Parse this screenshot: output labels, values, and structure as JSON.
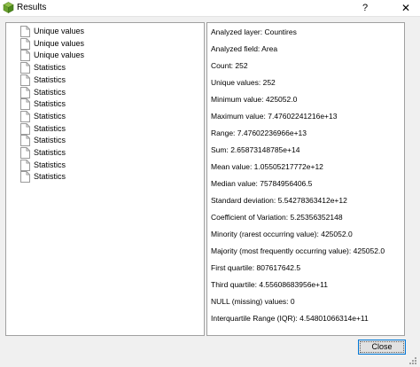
{
  "window": {
    "title": "Results",
    "help_label": "?",
    "close_label": "✕"
  },
  "tree": {
    "items": [
      "Unique values",
      "Unique values",
      "Unique values",
      "Statistics",
      "Statistics",
      "Statistics",
      "Statistics",
      "Statistics",
      "Statistics",
      "Statistics",
      "Statistics",
      "Statistics",
      "Statistics"
    ]
  },
  "details": {
    "lines": [
      "Analyzed layer: Countires",
      "Analyzed field: Area",
      "Count: 252",
      "Unique values: 252",
      "Minimum value: 425052.0",
      "Maximum value: 7.47602241216e+13",
      "Range: 7.47602236966e+13",
      "Sum: 2.65873148785e+14",
      "Mean value: 1.05505217772e+12",
      "Median value: 75784956406.5",
      "Standard deviation: 5.54278363412e+12",
      "Coefficient of Variation: 5.25356352148",
      "Minority (rarest occurring value): 425052.0",
      "Majority (most frequently occurring value): 425052.0",
      "First quartile: 807617642.5",
      "Third quartile: 4.55608683956e+11",
      "NULL (missing) values: 0",
      "Interquartile Range (IQR): 4.54801066314e+11"
    ]
  },
  "buttons": {
    "close_label": "Close"
  }
}
